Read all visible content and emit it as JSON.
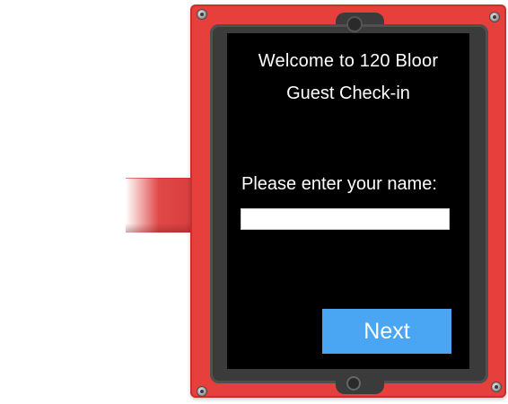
{
  "kiosk": {
    "welcome_text": "Welcome to 120 Bloor",
    "subtitle": "Guest Check-in",
    "name_prompt": "Please enter your name:",
    "name_input_value": "",
    "next_label": "Next"
  },
  "colors": {
    "case": "#e7403c",
    "bezel": "#3b3b3b",
    "screen": "#000000",
    "button": "#4aa5f3",
    "text": "#ffffff"
  }
}
